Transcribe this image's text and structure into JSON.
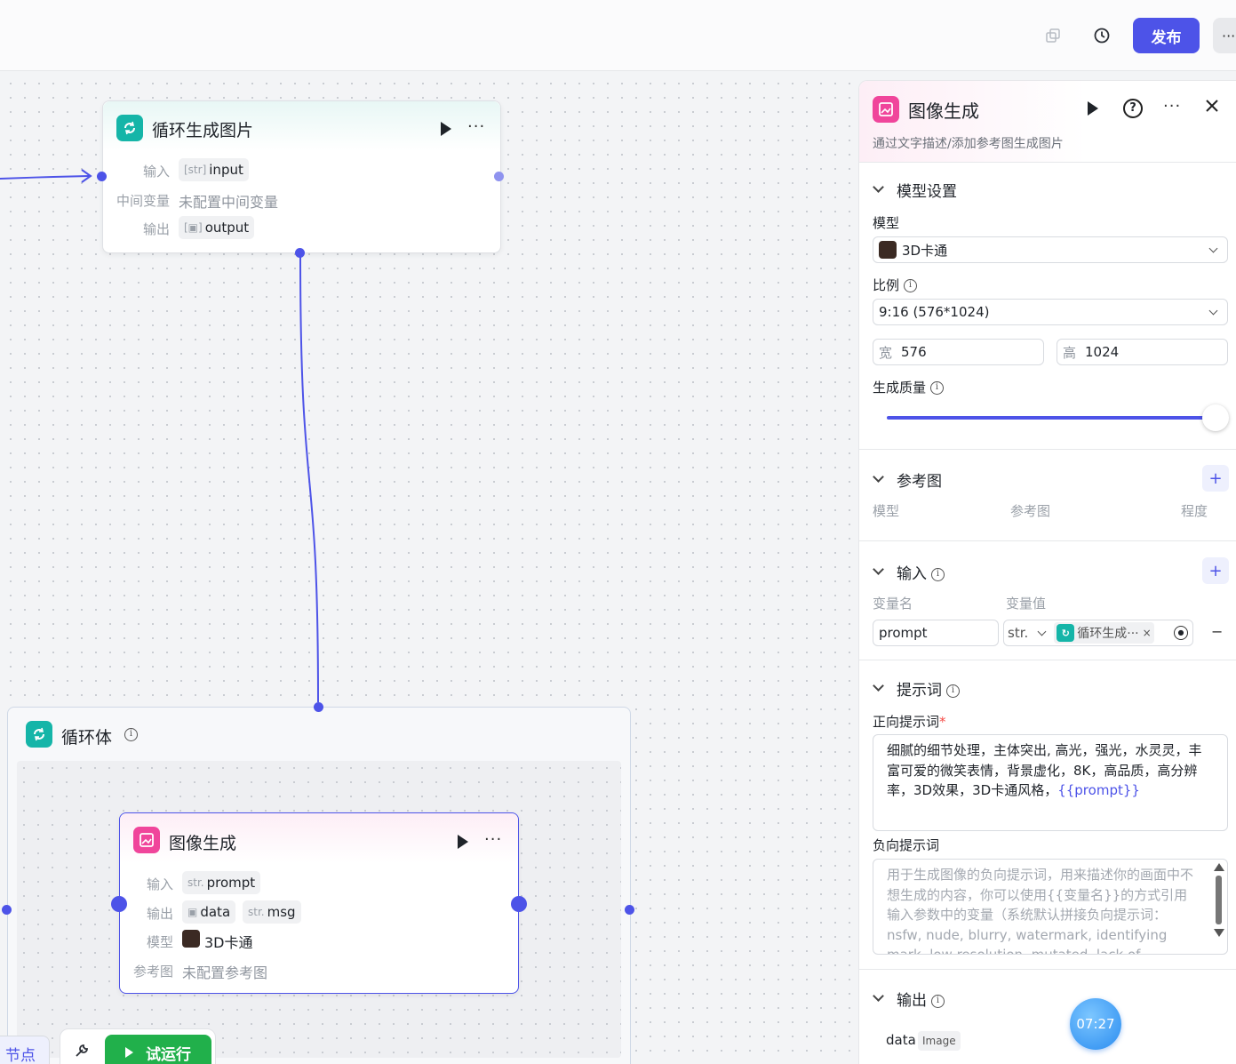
{
  "toolbar": {
    "publish_label": "发布",
    "more_label": "···"
  },
  "loop_node": {
    "title": "循环生成图片",
    "input_label": "输入",
    "input_type": "[str]",
    "input_value": "input",
    "mid_label": "中间变量",
    "mid_value": "未配置中间变量",
    "output_label": "输出",
    "output_value": "output"
  },
  "loop_body": {
    "title": "循环体"
  },
  "image_node": {
    "title": "图像生成",
    "input_label": "输入",
    "input_type": "str.",
    "input_value": "prompt",
    "output_label": "输出",
    "output_value_1": "data",
    "output_type_2": "str.",
    "output_value_2": "msg",
    "model_label": "模型",
    "model_value": "3D卡通",
    "ref_label": "参考图",
    "ref_value": "未配置参考图"
  },
  "bottom": {
    "node_label": "节点",
    "run_label": "试运行"
  },
  "panel": {
    "title": "图像生成",
    "description": "通过文字描述/添加参考图生成图片",
    "model_section": "模型设置",
    "model_label": "模型",
    "model_value": "3D卡通",
    "ratio_label": "比例",
    "ratio_value": "9:16 (576*1024)",
    "width_prefix": "宽",
    "width_value": "576",
    "height_prefix": "高",
    "height_value": "1024",
    "quality_label": "生成质量",
    "quality_fraction": 1.0,
    "ref_section": "参考图",
    "ref_cols": [
      "模型",
      "参考图",
      "程度"
    ],
    "input_section": "输入",
    "var_name_header": "变量名",
    "var_value_header": "变量值",
    "var_name": "prompt",
    "var_type": "str.",
    "var_ref": "循环生成···",
    "prompt_section": "提示词",
    "positive_label": "正向提示词",
    "positive_text": "细腻的细节处理，主体突出, 高光，强光，水灵灵，丰富可爱的微笑表情，背景虚化，8K，高品质，高分辨率，3D效果，3D卡通风格，",
    "positive_var": "{{prompt}}",
    "negative_label": "负向提示词",
    "negative_placeholder": "用于生成图像的负向提示词，用来描述你的画面中不想生成的内容，你可以使用{{变量名}}的方式引用输入参数中的变量（系统默认拼接负向提示词：nsfw, nude, blurry, watermark, identifying mark, low resolution, mutated, lack of hierarchy）",
    "output_section": "输出",
    "output_name": "data",
    "output_type": "Image"
  },
  "timer": "07:27",
  "colors": {
    "accent": "#4d53e8",
    "teal": "#15b5a8",
    "pink": "#f0459b"
  }
}
